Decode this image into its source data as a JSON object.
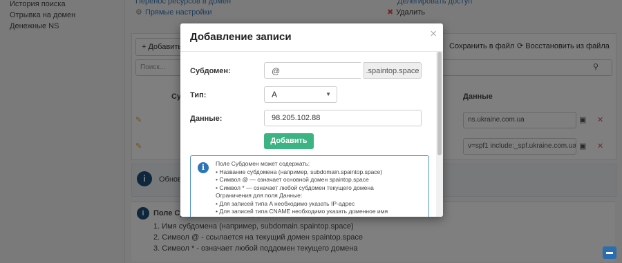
{
  "background": {
    "sidebar": {
      "items": [
        "История поиска",
        "Отрывка на домен",
        "Денежные NS"
      ]
    },
    "top_links": {
      "left": "Перенос ресурсов в домен",
      "left2": "Прямые настройки",
      "right": "Делегировать доступ",
      "right2": "Удалить"
    },
    "toolbar": {
      "add_label": "Добавить",
      "save_file_label": "Сохранить в файл",
      "restore_label": "Восстановить из файла",
      "search_placeholder": "Поиск..."
    },
    "table": {
      "col_subdomain": "Субдомен",
      "col_data": "Данные",
      "rows": [
        {
          "data": "ns.ukraine.com.ua"
        },
        {
          "data": "v=spf1 include:_spf.ukraine.com.ua"
        }
      ]
    },
    "info_bar": {
      "text": "Обновления..."
    },
    "bottom_panel": {
      "title": "Поле Субдомен может содержать:",
      "items": [
        "Имя субдомена (например, subdomain.spaintop.space)",
        "Символ @ - ссылается на текущий домен spaintop.space",
        "Символ * - означает любой поддомен текущего домена"
      ]
    }
  },
  "modal": {
    "title": "Добавление записи",
    "close_label": "×",
    "form": {
      "subdomain_label": "Субдомен:",
      "subdomain_value": "@",
      "subdomain_suffix": ".spaintop.space",
      "type_label": "Тип:",
      "type_value": "A",
      "data_label": "Данные:",
      "data_value": "98.205.102.88",
      "submit_label": "Добавить"
    },
    "info": {
      "line1": "Поле Субдомен может содержать:",
      "line2": "• Название субдомена (например, subdomain.spaintop.space)",
      "line3": "• Символ @ — означает основной домен spaintop.space",
      "line4": "• Символ * — означает любой субдомен текущего домена",
      "line5": "Ограничения для поля Данные:",
      "line6": "• Для записей типа A необходимо указать IP-адрес",
      "line7": "• Для записей типа CNAME необходимо указать доменное имя"
    }
  },
  "colors": {
    "primary_button": "#3cb383",
    "info_border": "#4a8fc7",
    "info_icon": "#2e75b6"
  }
}
